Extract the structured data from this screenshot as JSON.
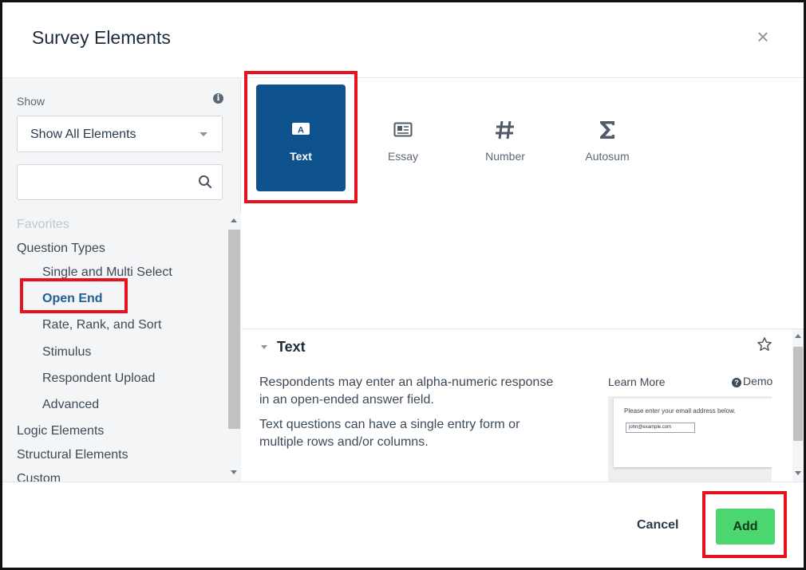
{
  "dialog": {
    "title": "Survey Elements",
    "close_icon": "close-icon"
  },
  "sidebar": {
    "show_label": "Show",
    "filter_select": {
      "value": "Show All Elements"
    },
    "search": {
      "placeholder": "",
      "value": ""
    },
    "tree": [
      {
        "label": "Favorites",
        "level": "category",
        "state": "faded"
      },
      {
        "label": "Question Types",
        "level": "category",
        "state": "normal"
      },
      {
        "label": "Single and Multi Select",
        "level": "sub",
        "state": "normal"
      },
      {
        "label": "Open End",
        "level": "sub",
        "state": "active"
      },
      {
        "label": "Rate, Rank, and Sort",
        "level": "sub",
        "state": "normal"
      },
      {
        "label": "Stimulus",
        "level": "sub",
        "state": "normal"
      },
      {
        "label": "Respondent Upload",
        "level": "sub",
        "state": "normal"
      },
      {
        "label": "Advanced",
        "level": "sub",
        "state": "normal"
      },
      {
        "label": "Logic Elements",
        "level": "category",
        "state": "normal"
      },
      {
        "label": "Structural Elements",
        "level": "category",
        "state": "normal"
      },
      {
        "label": "Custom",
        "level": "category",
        "state": "normal"
      }
    ]
  },
  "elements": [
    {
      "label": "Text",
      "icon": "text-field-icon",
      "selected": true
    },
    {
      "label": "Essay",
      "icon": "essay-icon",
      "selected": false
    },
    {
      "label": "Number",
      "icon": "hash-icon",
      "selected": false
    },
    {
      "label": "Autosum",
      "icon": "sigma-icon",
      "selected": false
    }
  ],
  "details": {
    "title": "Text",
    "description": [
      "Respondents may enter an alpha-numeric response in an open-ended answer field.",
      "Text questions can have a single entry form or multiple rows and/or columns."
    ],
    "learn_more": "Learn More",
    "demo": "Demo",
    "preview": {
      "question": "Please enter your email address below.",
      "input_value": "john@example.com"
    }
  },
  "footer": {
    "cancel_label": "Cancel",
    "add_label": "Add"
  },
  "colors": {
    "accent": "#0d528c",
    "add_button": "#4cd66f",
    "highlight": "#e8121c",
    "active_link": "#1f5f99"
  }
}
